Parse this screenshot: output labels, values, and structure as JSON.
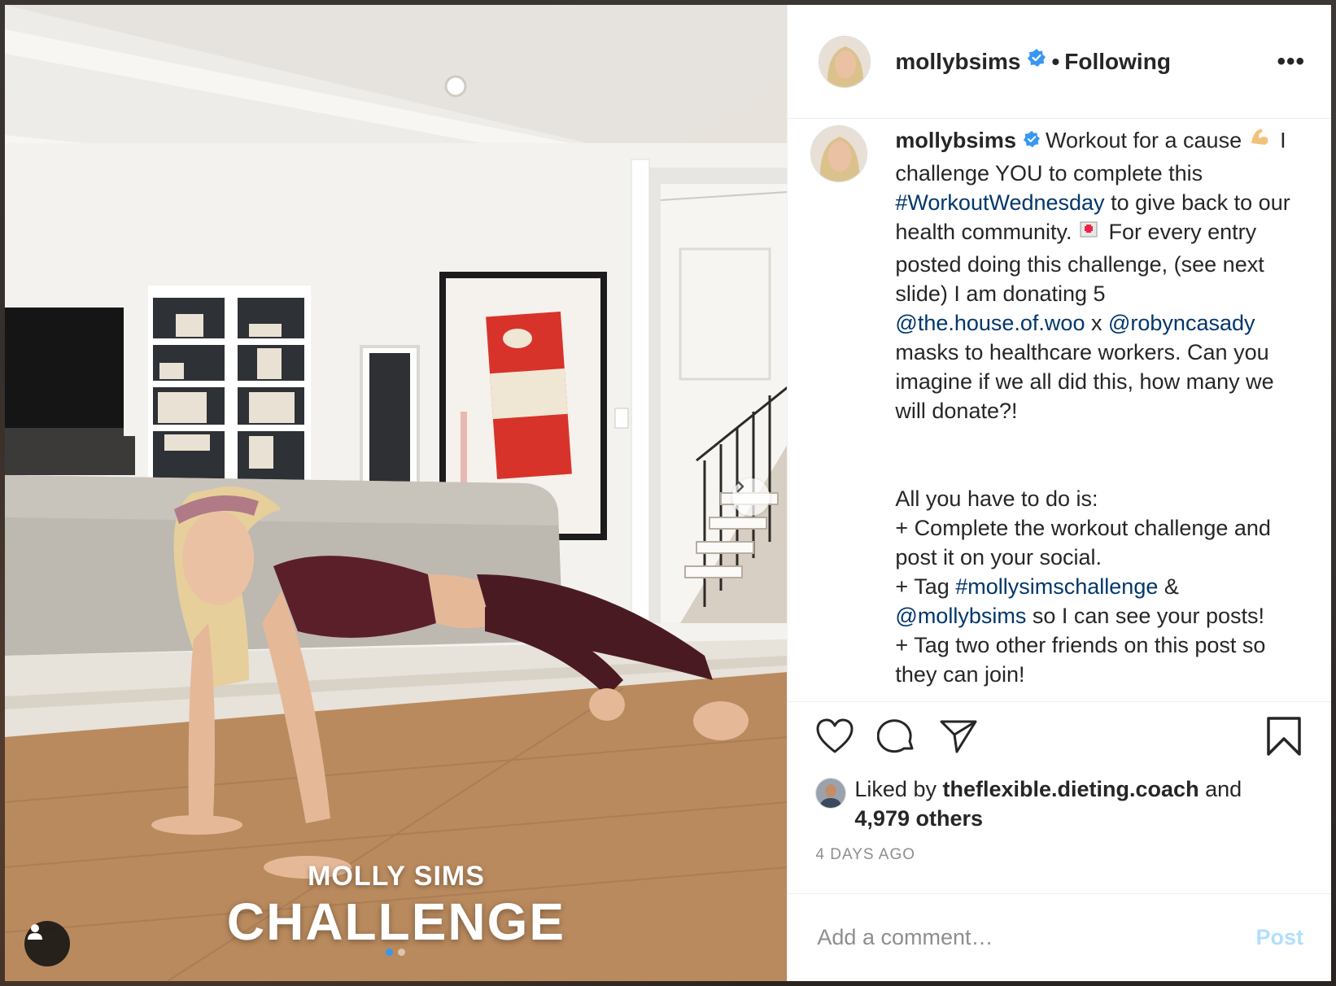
{
  "post": {
    "author": "mollybsims",
    "separator": "•",
    "follow_status": "Following",
    "more_label": "•••",
    "overlay_line1": "MOLLY SIMS",
    "overlay_line2": "CHALLENGE",
    "carousel": {
      "current": 1,
      "total": 2
    }
  },
  "caption": {
    "username": "mollybsims",
    "intro": "Workout for a cause",
    "line2": "I challenge YOU to complete this",
    "hashtag1": "#WorkoutWednesday",
    "line3": "to give back to our health community.",
    "line4": "For every entry posted doing this challenge, (see next slide) I am donating 5",
    "mention1": "@the.house.of.woo",
    "x": "x",
    "mention2": "@robyncasady",
    "line5": "masks to healthcare workers. Can you imagine if we all did this, how many we will donate?!",
    "line6": "All you have to do is:",
    "line7": "+ Complete the workout challenge and post it on your social.",
    "line8a": "+ Tag",
    "hashtag2": "#mollysimschallenge",
    "amp": "&",
    "mention3": "@mollybsims",
    "line8b": "so I can see your posts!",
    "line9": "+ Tag two other friends on this post so they can join!"
  },
  "likes": {
    "prefix": "Liked by",
    "user": "theflexible.dieting.coach",
    "and": "and",
    "others": "4,979 others"
  },
  "time_ago": "4 DAYS AGO",
  "comment": {
    "placeholder": "Add a comment…",
    "post_label": "Post"
  },
  "colors": {
    "link": "#00376b",
    "verified": "#3897f0",
    "post_disabled": "#b2dffc"
  },
  "icons": [
    "user-tag-icon",
    "chevron-right-icon",
    "verified-badge-icon",
    "heart-icon",
    "comment-icon",
    "share-icon",
    "bookmark-icon",
    "flexed-biceps-icon",
    "hospital-icon"
  ]
}
